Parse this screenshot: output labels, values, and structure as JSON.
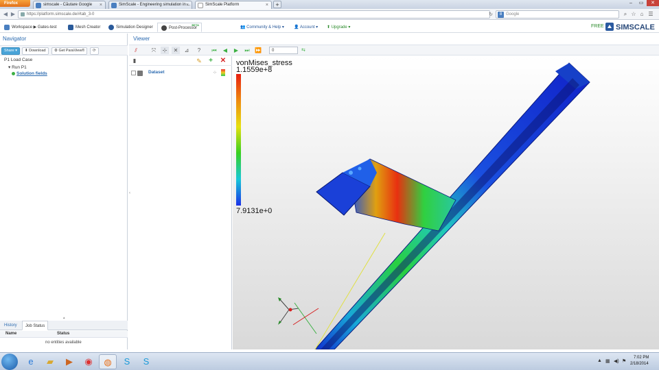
{
  "browser": {
    "app_button": "Firefox",
    "tabs": [
      {
        "label": "simscale - Căutare Google",
        "active": false
      },
      {
        "label": "SimScale - Engineering simulation in ...",
        "active": false
      },
      {
        "label": "SimScale Platform",
        "active": true
      }
    ],
    "new_tab": "+",
    "url": "https://platform.simscale.de/#tab_3-0",
    "search_engine_icon": "8",
    "search_placeholder": "Google"
  },
  "app_header": {
    "tabs": [
      {
        "label": "Workspace ▶ Gates-test",
        "icon": "workspace-icon",
        "color": "#4a7fc0"
      },
      {
        "label": "Mesh Creator",
        "icon": "mesh-icon",
        "color": "#2a5a9a"
      },
      {
        "label": "Simulation Designer",
        "icon": "gears-icon",
        "color": "#2a5a9a"
      },
      {
        "label": "Post-Processor",
        "icon": "postprocessor-icon",
        "color": "#444444"
      }
    ],
    "beta_badge": "BETA",
    "menu": [
      {
        "label": "Community & Help ▾"
      },
      {
        "label": "Account ▾"
      },
      {
        "label": "Upgrade ▾"
      }
    ],
    "free_label": "FREE",
    "logo_text": "SIMSCALE"
  },
  "navigator": {
    "title": "Navigator",
    "toolbar": {
      "share": "Share ▾",
      "download": "Download",
      "paraview": "Get ParaView®",
      "refresh": "⟳"
    },
    "tree": [
      {
        "label": "P1 Load Case",
        "level": 0,
        "link": false
      },
      {
        "label": "Run P1",
        "level": 1,
        "link": false
      },
      {
        "label": "Solution fields",
        "level": 2,
        "link": true
      }
    ],
    "bottom_tabs": [
      {
        "label": "History",
        "active": false
      },
      {
        "label": "Job Status",
        "active": true
      }
    ],
    "status_table": {
      "columns": [
        "Name",
        "Status"
      ],
      "empty_message": "no entities available"
    }
  },
  "viewer": {
    "title": "Viewer",
    "frame_value": "0",
    "pipeline": {
      "dataset_label": "Dataset"
    },
    "legend": {
      "field": "vonMises_stress",
      "max": "1.1559e+8",
      "min": "7.9131e+0"
    }
  },
  "taskbar": {
    "time": "7:02 PM",
    "date": "2/18/2014"
  },
  "colors": {
    "accent": "#2a6ab0",
    "share_button": "#4aa4d8",
    "free_green": "#2a8a2a"
  }
}
